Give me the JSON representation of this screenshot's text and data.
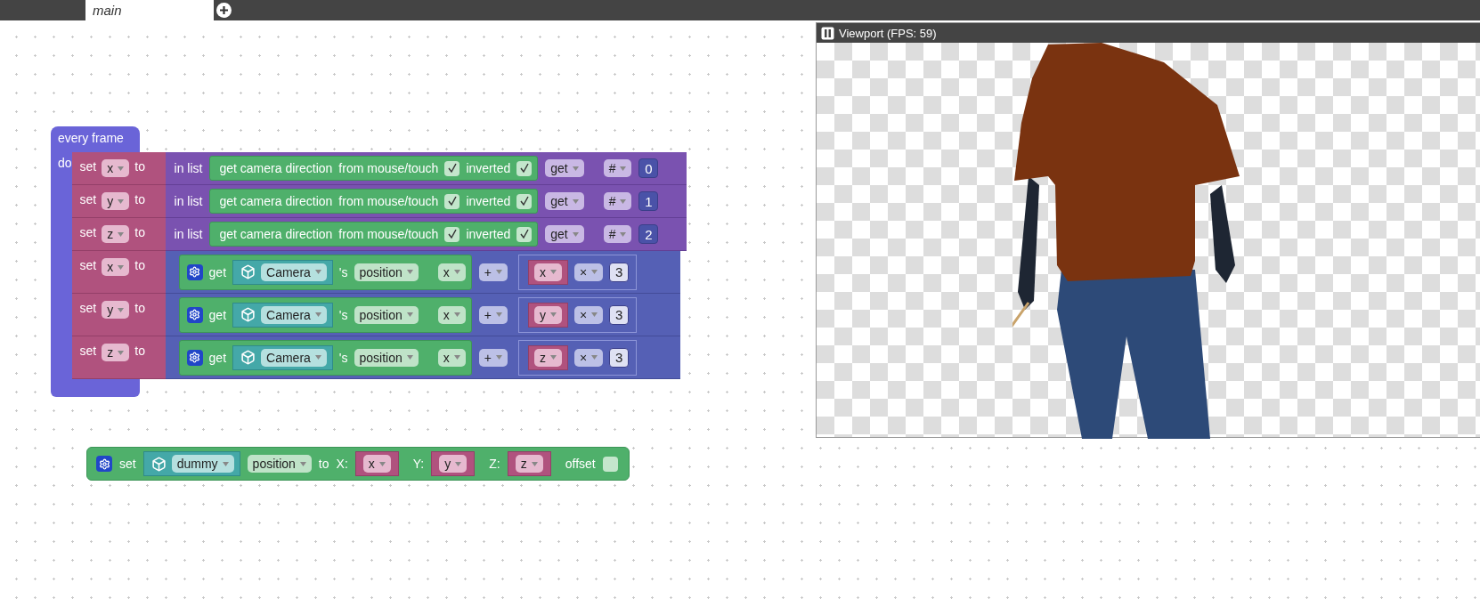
{
  "tabs": [
    {
      "label": "main",
      "selected": true
    }
  ],
  "viewport": {
    "title": "Viewport (FPS: 59)"
  },
  "event_block": {
    "label": "every frame",
    "do_label": "do",
    "statements": [
      {
        "set_label": "set",
        "variable": "x",
        "to_label": "to",
        "value": {
          "kind": "list_get",
          "label": "in list",
          "source": {
            "label": "get camera direction",
            "from_label": "from mouse/touch",
            "from_checked": true,
            "inverted_label": "inverted",
            "inverted_checked": true
          },
          "mode": "get",
          "where": "#",
          "index": "0"
        }
      },
      {
        "set_label": "set",
        "variable": "y",
        "to_label": "to",
        "value": {
          "kind": "list_get",
          "label": "in list",
          "source": {
            "label": "get camera direction",
            "from_label": "from mouse/touch",
            "from_checked": true,
            "inverted_label": "inverted",
            "inverted_checked": true
          },
          "mode": "get",
          "where": "#",
          "index": "1"
        }
      },
      {
        "set_label": "set",
        "variable": "z",
        "to_label": "to",
        "value": {
          "kind": "list_get",
          "label": "in list",
          "source": {
            "label": "get camera direction",
            "from_label": "from mouse/touch",
            "from_checked": true,
            "inverted_label": "inverted",
            "inverted_checked": true
          },
          "mode": "get",
          "where": "#",
          "index": "2"
        }
      },
      {
        "set_label": "set",
        "variable": "x",
        "to_label": "to",
        "value": {
          "kind": "arithmetic",
          "op": "+",
          "left": {
            "get_label": "get",
            "object": "Camera",
            "possessive": "'s",
            "property": "position",
            "axis": "x"
          },
          "right": {
            "variable": "x",
            "op": "×",
            "number": "3"
          }
        }
      },
      {
        "set_label": "set",
        "variable": "y",
        "to_label": "to",
        "value": {
          "kind": "arithmetic",
          "op": "+",
          "left": {
            "get_label": "get",
            "object": "Camera",
            "possessive": "'s",
            "property": "position",
            "axis": "x"
          },
          "right": {
            "variable": "y",
            "op": "×",
            "number": "3"
          }
        }
      },
      {
        "set_label": "set",
        "variable": "z",
        "to_label": "to",
        "value": {
          "kind": "arithmetic",
          "op": "+",
          "left": {
            "get_label": "get",
            "object": "Camera",
            "possessive": "'s",
            "property": "position",
            "axis": "x"
          },
          "right": {
            "variable": "z",
            "op": "×",
            "number": "3"
          }
        }
      }
    ]
  },
  "set_position_block": {
    "set_label": "set",
    "object": "dummy",
    "property": "position",
    "to_label": "to",
    "coords": [
      {
        "label": "X:",
        "variable": "x"
      },
      {
        "label": "Y:",
        "variable": "y"
      },
      {
        "label": "Z:",
        "variable": "z"
      }
    ],
    "offset_label": "offset",
    "offset_checked": false
  }
}
